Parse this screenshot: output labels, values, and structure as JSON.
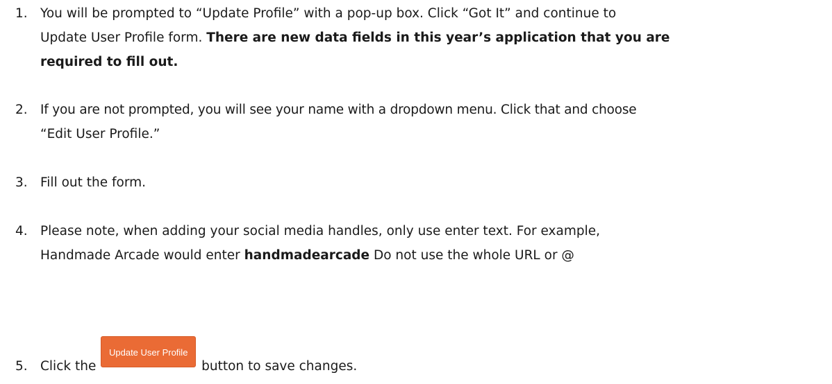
{
  "steps": [
    {
      "number": "1.",
      "line1": "You will be prompted to “Update Profile” with a pop-up box. Click “Got It” and continue to",
      "line2_plain": "Update User Profile form. ",
      "line2_bold": "There are new data fields in this year’s application that you are",
      "line3_bold": "required to fill out."
    },
    {
      "number": "2.",
      "line1": "If you are not prompted, you will see your name with a dropdown menu. Click that and choose",
      "line2": "“Edit User Profile.”"
    },
    {
      "number": "3.",
      "line1": "Fill out the form."
    },
    {
      "number": "4.",
      "line1": "Please note, when adding your social media handles, only use enter text. For example,",
      "line2_plain_before": "Handmade Arcade would enter ",
      "line2_bold": "handmadearcade",
      "line2_plain_after": " Do not use the whole URL or @"
    },
    {
      "number": "5.",
      "text_before": "Click the ",
      "button_label": "Update User Profile",
      "text_after": " button to save changes."
    }
  ],
  "colors": {
    "button_bg": "#ea6b35",
    "button_text": "#ffffff",
    "text": "#1a1a1a"
  }
}
